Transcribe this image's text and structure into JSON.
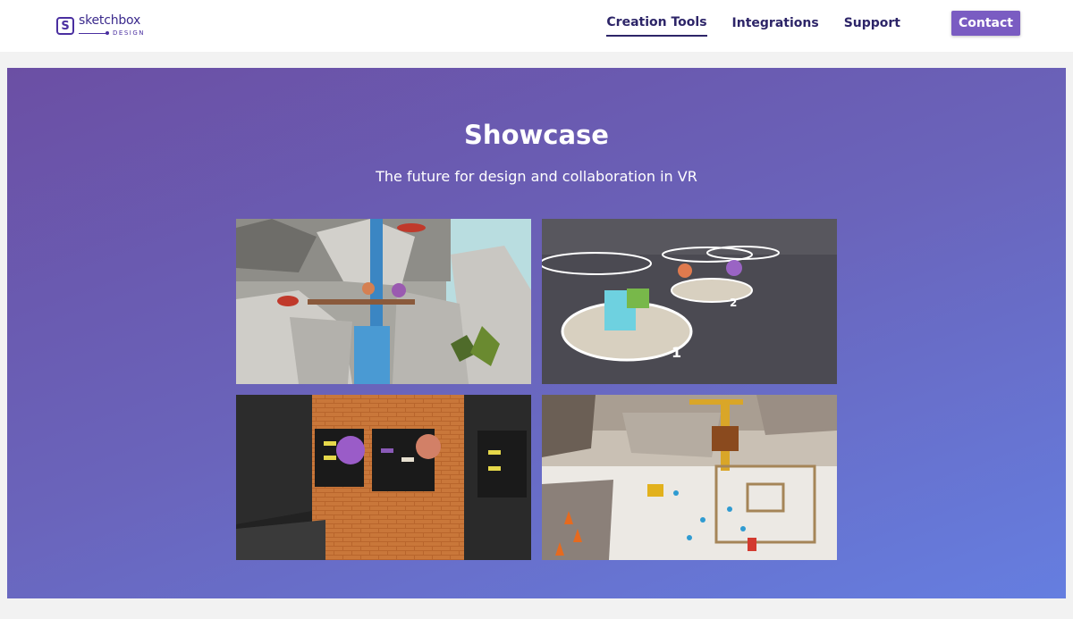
{
  "logo": {
    "mark": "S",
    "word": "sketchbox",
    "sub": "DESIGN"
  },
  "nav": {
    "items": [
      {
        "label": "Creation Tools",
        "active": true
      },
      {
        "label": "Integrations",
        "active": false
      },
      {
        "label": "Support",
        "active": false
      }
    ],
    "contact_label": "Contact"
  },
  "hero": {
    "title": "Showcase",
    "subtitle": "The future for design and collaboration in VR"
  },
  "showcase": {
    "tiles": [
      {
        "name": "rock-island-scene"
      },
      {
        "name": "stage-platforms-scene"
      },
      {
        "name": "brick-wall-shoe-store-scene"
      },
      {
        "name": "construction-site-scene"
      }
    ],
    "step_numbers": [
      "1",
      "2"
    ]
  },
  "colors": {
    "brand": "#4a2fa0",
    "nav_text": "#2d2568",
    "button": "#7a5cc2",
    "hero_start": "#6b4fa4",
    "hero_end": "#657ee0"
  }
}
